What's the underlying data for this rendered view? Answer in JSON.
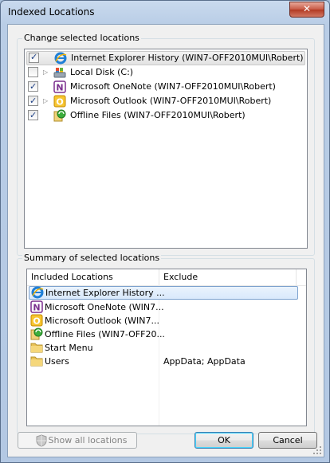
{
  "window": {
    "title": "Indexed Locations",
    "close_glyph": "✕"
  },
  "change_group": {
    "label": "Change selected locations",
    "items": [
      {
        "label": "Internet Explorer History (WIN7-OFF2010MUI\\Robert)",
        "checked": true,
        "expandable": false,
        "icon": "ie-history-icon"
      },
      {
        "label": "Local Disk (C:)",
        "checked": false,
        "expandable": true,
        "icon": "local-disk-icon"
      },
      {
        "label": "Microsoft OneNote (WIN7-OFF2010MUI\\Robert)",
        "checked": true,
        "expandable": false,
        "icon": "onenote-icon"
      },
      {
        "label": "Microsoft Outlook (WIN7-OFF2010MUI\\Robert)",
        "checked": true,
        "expandable": true,
        "icon": "outlook-icon"
      },
      {
        "label": "Offline Files (WIN7-OFF2010MUI\\Robert)",
        "checked": true,
        "expandable": false,
        "icon": "offline-files-icon"
      }
    ]
  },
  "summary_group": {
    "label": "Summary of selected locations",
    "columns": {
      "included": "Included Locations",
      "exclude": "Exclude"
    },
    "rows": [
      {
        "included": "Internet Explorer History ...",
        "exclude": "",
        "icon": "ie-history-icon"
      },
      {
        "included": "Microsoft OneNote (WIN7...",
        "exclude": "",
        "icon": "onenote-icon"
      },
      {
        "included": "Microsoft Outlook (WIN7...",
        "exclude": "",
        "icon": "outlook-icon"
      },
      {
        "included": "Offline Files (WIN7-OFF20...",
        "exclude": "",
        "icon": "offline-files-icon"
      },
      {
        "included": "Start Menu",
        "exclude": "",
        "icon": "folder-icon"
      },
      {
        "included": "Users",
        "exclude": "AppData; AppData",
        "icon": "folder-icon"
      }
    ]
  },
  "buttons": {
    "show_all": "Show all locations",
    "ok": "OK",
    "cancel": "Cancel"
  },
  "colors": {
    "title_bar": "#b9cde6",
    "selection_border": "#7da2ce",
    "onenote": "#7a2e8e",
    "outlook": "#e8a400"
  }
}
